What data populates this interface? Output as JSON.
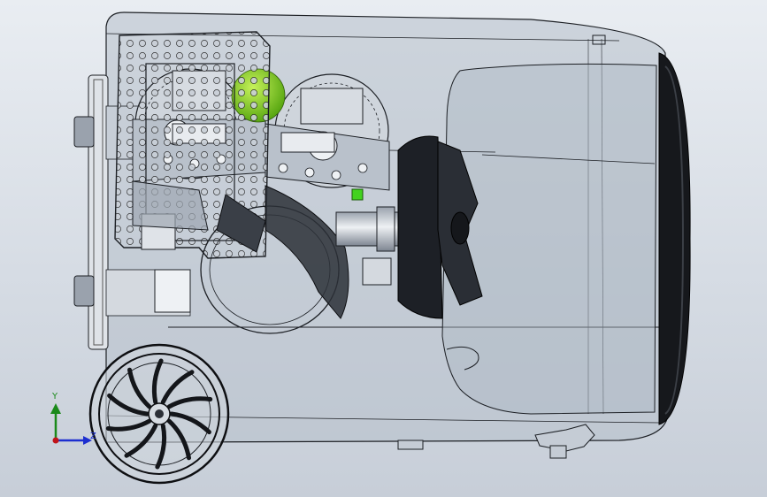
{
  "view": {
    "background_top": "#e9edf2",
    "background_bottom": "#c7ced8",
    "body_fill": "#b7c0cb",
    "line_color": "#1c1f24",
    "rim_color": "#0e0f12",
    "accent_green": "#7fd11a"
  },
  "triad": {
    "y_label": "Y",
    "z_label": "Z",
    "y_color": "#1a8a1a",
    "z_color": "#1d2fd0",
    "x_color": "#c0141a"
  },
  "components": [
    {
      "id": "housing",
      "icon": "transparent-shell"
    },
    {
      "id": "front-rim",
      "icon": "rubber-seal"
    },
    {
      "id": "perforated-frame",
      "icon": "perforated-plate"
    },
    {
      "id": "gear-wheels",
      "icon": "gear"
    },
    {
      "id": "impeller",
      "icon": "fan-blades"
    },
    {
      "id": "drive-shaft",
      "icon": "shaft"
    },
    {
      "id": "caster-wheel",
      "icon": "spoked-wheel"
    },
    {
      "id": "ball",
      "icon": "sphere"
    }
  ]
}
